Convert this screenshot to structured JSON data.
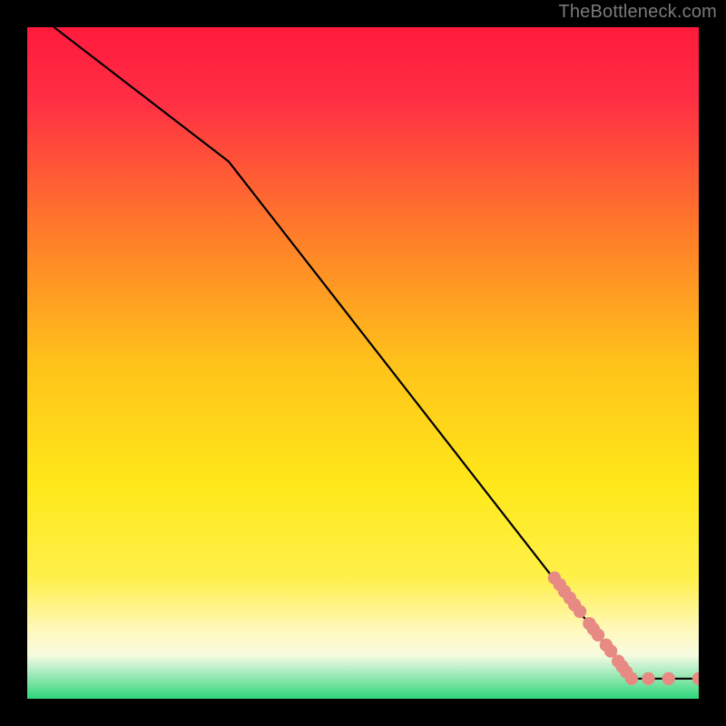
{
  "attribution": "TheBottleneck.com",
  "colors": {
    "frame": "#000000",
    "attribution": "#7a7a7a",
    "line": "#000000",
    "marker": "#e88a84",
    "gradient_top": "#ff1a3c",
    "gradient_mid_upper": "#ff7a2a",
    "gradient_mid": "#ffe81a",
    "gradient_mid_lower": "#fff8c0",
    "gradient_green_top": "#c9f2d0",
    "gradient_green_bottom": "#2fd67a"
  },
  "chart_data": {
    "type": "line",
    "title": "",
    "xlabel": "",
    "ylabel": "",
    "xlim": [
      0,
      100
    ],
    "ylim": [
      0,
      100
    ],
    "line": [
      {
        "x": 4,
        "y": 100
      },
      {
        "x": 30,
        "y": 80
      },
      {
        "x": 90,
        "y": 3
      },
      {
        "x": 100,
        "y": 3
      }
    ],
    "markers": [
      {
        "x": 78.5,
        "y": 18.0
      },
      {
        "x": 79.3,
        "y": 17.0
      },
      {
        "x": 80.0,
        "y": 16.0
      },
      {
        "x": 80.8,
        "y": 15.0
      },
      {
        "x": 81.5,
        "y": 14.0
      },
      {
        "x": 82.3,
        "y": 13.0
      },
      {
        "x": 83.7,
        "y": 11.2
      },
      {
        "x": 84.3,
        "y": 10.4
      },
      {
        "x": 85.0,
        "y": 9.5
      },
      {
        "x": 86.2,
        "y": 8.0
      },
      {
        "x": 86.9,
        "y": 7.1
      },
      {
        "x": 88.0,
        "y": 5.6
      },
      {
        "x": 88.6,
        "y": 4.8
      },
      {
        "x": 89.2,
        "y": 4.0
      },
      {
        "x": 90.0,
        "y": 3.0
      },
      {
        "x": 92.5,
        "y": 3.0
      },
      {
        "x": 95.5,
        "y": 3.0
      },
      {
        "x": 100.0,
        "y": 3.0
      }
    ]
  }
}
